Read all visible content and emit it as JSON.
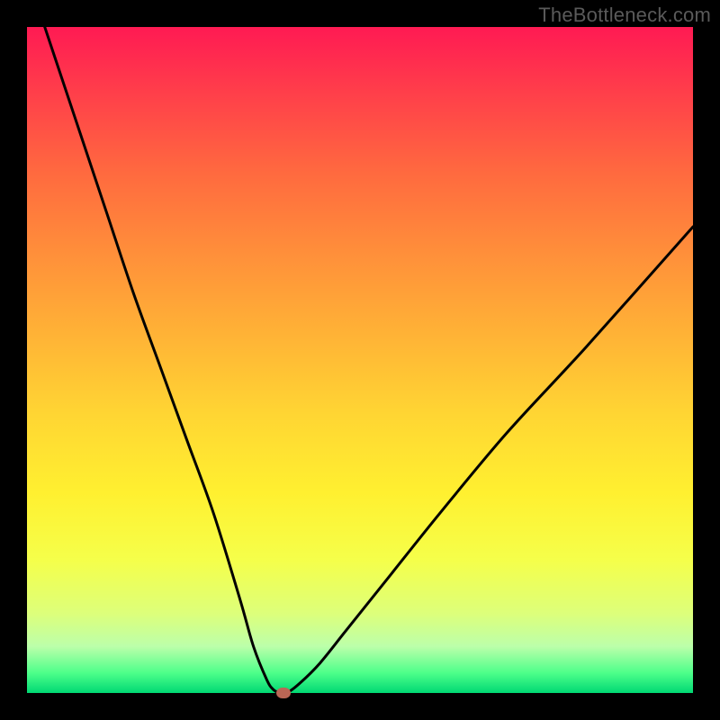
{
  "watermark": "TheBottleneck.com",
  "chart_data": {
    "type": "line",
    "title": "",
    "xlabel": "",
    "ylabel": "",
    "xlim": [
      0,
      100
    ],
    "ylim": [
      0,
      100
    ],
    "grid": false,
    "legend": false,
    "gradient_stops": [
      {
        "pos": 0,
        "color": "#ff1a53"
      },
      {
        "pos": 10,
        "color": "#ff3f4a"
      },
      {
        "pos": 22,
        "color": "#ff6a3f"
      },
      {
        "pos": 34,
        "color": "#ff8f3a"
      },
      {
        "pos": 46,
        "color": "#ffb236"
      },
      {
        "pos": 58,
        "color": "#ffd533"
      },
      {
        "pos": 70,
        "color": "#fff030"
      },
      {
        "pos": 80,
        "color": "#f5ff4a"
      },
      {
        "pos": 88,
        "color": "#ddff7a"
      },
      {
        "pos": 93,
        "color": "#bcffaa"
      },
      {
        "pos": 97,
        "color": "#4dff8a"
      },
      {
        "pos": 100,
        "color": "#00d873"
      }
    ],
    "series": [
      {
        "name": "bottleneck-curve",
        "x": [
          0,
          4,
          8,
          12,
          16,
          20,
          24,
          28,
          32,
          34,
          36,
          37,
          38,
          39,
          41,
          44,
          48,
          54,
          62,
          72,
          84,
          100
        ],
        "y": [
          108,
          96,
          84,
          72,
          60,
          49,
          38,
          27,
          14,
          7,
          2,
          0.5,
          0,
          0,
          1.5,
          4.5,
          9.5,
          17,
          27,
          39,
          52,
          70
        ]
      }
    ],
    "marker": {
      "x": 38.5,
      "y": 0,
      "color": "#bb6655"
    },
    "annotations": []
  }
}
